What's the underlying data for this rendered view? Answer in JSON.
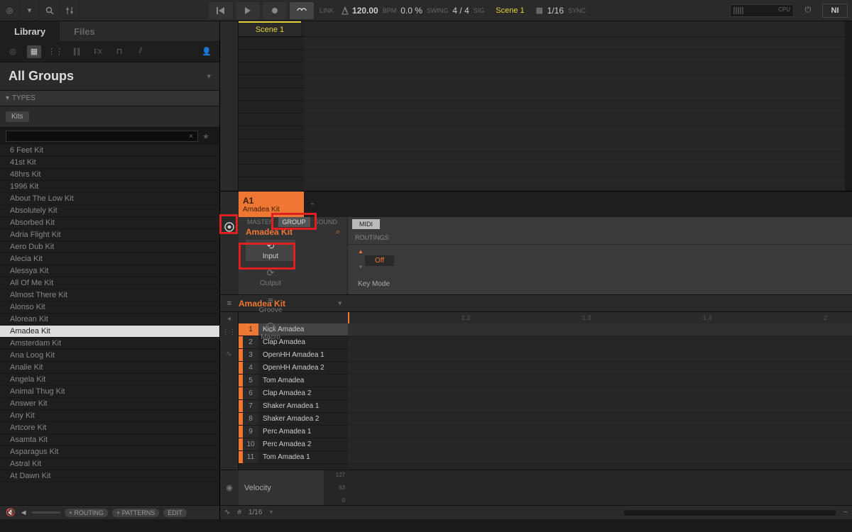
{
  "header": {
    "bpm_value": "120.00",
    "bpm_label": "BPM",
    "swing_value": "0.0 %",
    "swing_label": "SWING",
    "sig_value": "4 / 4",
    "sig_label": "SIG",
    "scene": "Scene 1",
    "sync_value": "1/16",
    "sync_label": "SYNC",
    "link_label": "LINK",
    "cpu_label": "CPU"
  },
  "browser": {
    "tabs": {
      "library": "Library",
      "files": "Files"
    },
    "all_groups": "All Groups",
    "types_header": "TYPES",
    "type_tag": "Kits",
    "search_clear": "×",
    "kits": [
      "6 Feet Kit",
      "41st Kit",
      "48hrs Kit",
      "1996 Kit",
      "About The Low Kit",
      "Absolutely Kit",
      "Absorbed Kit",
      "Adria Flight Kit",
      "Aero Dub Kit",
      "Alecia Kit",
      "Alessya Kit",
      "All Of Me Kit",
      "Almost There Kit",
      "Alonso Kit",
      "Alorean Kit",
      "Amadea Kit",
      "Amsterdam Kit",
      "Ana Loog Kit",
      "Analie Kit",
      "Angela Kit",
      "Animal Thug Kit",
      "Answer Kit",
      "Any Kit",
      "Artcore Kit",
      "Asamta Kit",
      "Asparagus Kit",
      "Astral Kit",
      "At Dawn Kit"
    ],
    "selected_kit": "Amadea Kit",
    "footer": {
      "routing": "+ ROUTING",
      "patterns": "+ PATTERNS",
      "edit": "EDIT"
    }
  },
  "arranger": {
    "scene_tab": "Scene 1"
  },
  "group": {
    "id": "A1",
    "name": "Amadea Kit",
    "add": "+"
  },
  "control": {
    "tabs": {
      "master": "MASTER",
      "group": "GROUP",
      "sound": "SOUND"
    },
    "name": "Amadea Kit",
    "buttons": {
      "input": "Input",
      "output": "Output",
      "groove": "Groove",
      "macro": "Macro"
    },
    "midi_tab": "MIDI",
    "routings": "ROUTINGS",
    "routing_value": "Off",
    "keymode_label": "Key Mode"
  },
  "pattern": {
    "name": "Amadea Kit",
    "timeline": [
      "1.2",
      "1.3",
      "1.4",
      "2"
    ],
    "sounds": [
      {
        "n": "1",
        "name": "Kick Amadea"
      },
      {
        "n": "2",
        "name": "Clap Amadea"
      },
      {
        "n": "3",
        "name": "OpenHH Amadea 1"
      },
      {
        "n": "4",
        "name": "OpenHH Amadea 2"
      },
      {
        "n": "5",
        "name": "Tom Amadea"
      },
      {
        "n": "6",
        "name": "Clap Amadea 2"
      },
      {
        "n": "7",
        "name": "Shaker Amadea 1"
      },
      {
        "n": "8",
        "name": "Shaker Amadea 2"
      },
      {
        "n": "9",
        "name": "Perc Amadea 1"
      },
      {
        "n": "10",
        "name": "Perc Amadea 2"
      },
      {
        "n": "11",
        "name": "Tom Amadea 1"
      }
    ],
    "velocity_label": "Velocity",
    "velocity_scale": [
      "127",
      "63",
      "0"
    ],
    "footer_grid": "1/16"
  }
}
